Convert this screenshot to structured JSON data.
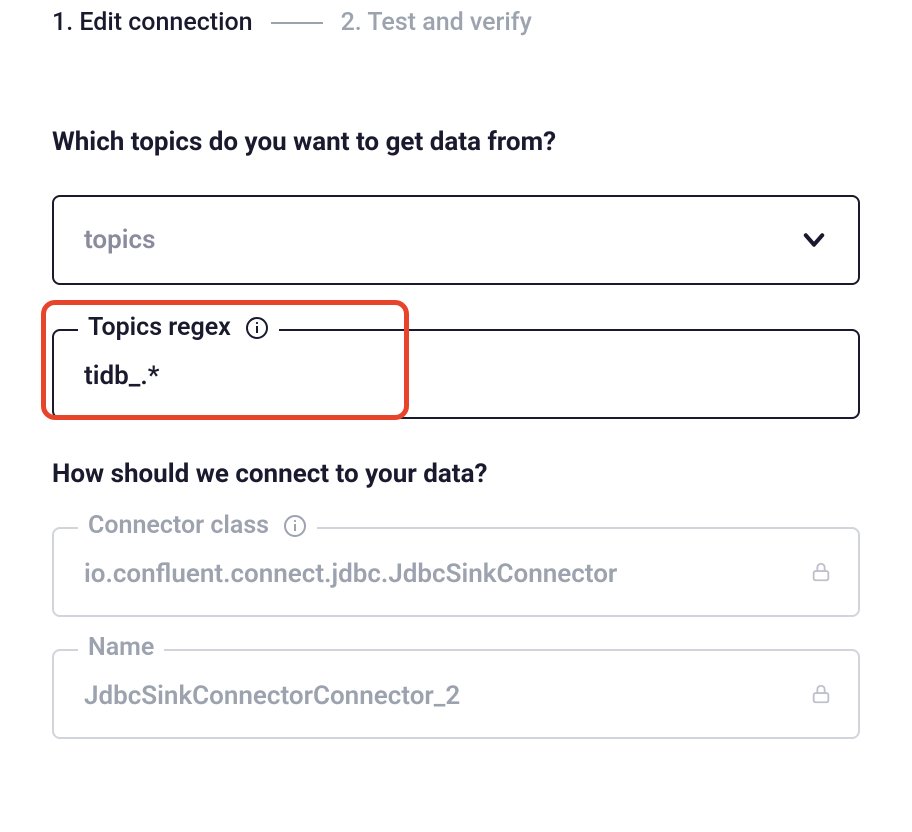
{
  "stepper": {
    "step1_label": "1. Edit connection",
    "step2_label": "2. Test and verify"
  },
  "topics_section": {
    "heading": "Which topics do you want to get data from?",
    "dropdown_placeholder": "topics",
    "regex_label": "Topics regex",
    "regex_value": "tidb_.*"
  },
  "connect_section": {
    "heading": "How should we connect to your data?",
    "connector_class_label": "Connector class",
    "connector_class_value": "io.confluent.connect.jdbc.JdbcSinkConnector",
    "name_label": "Name",
    "name_value": "JdbcSinkConnectorConnector_2"
  }
}
